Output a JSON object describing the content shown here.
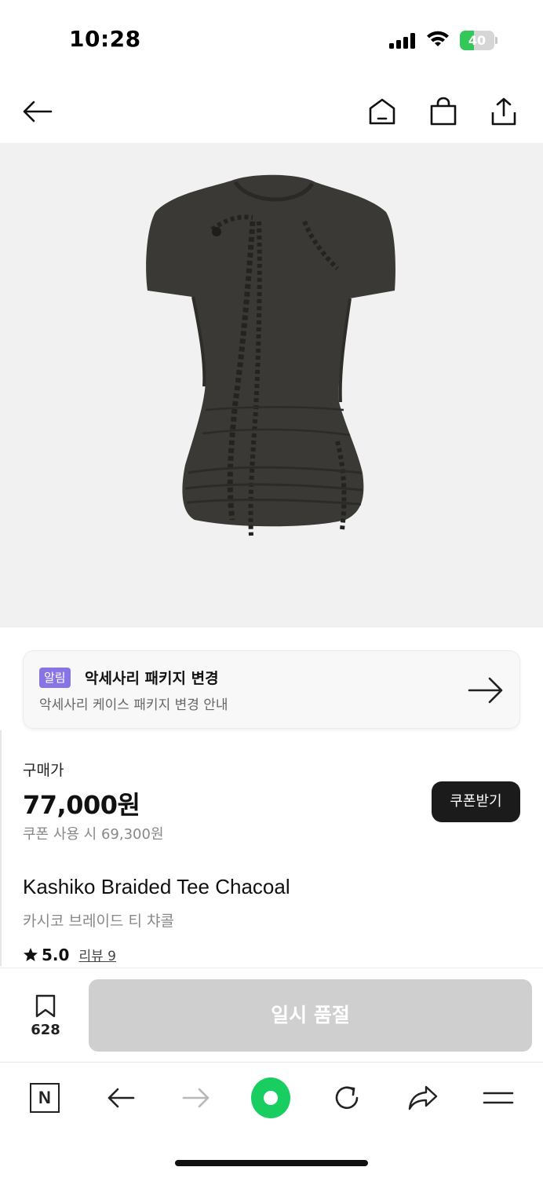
{
  "status_bar": {
    "time": "10:28",
    "battery": "40",
    "battery_level": 0.4,
    "battery_color": "#34c759"
  },
  "nav": {
    "icons": [
      "back-arrow-icon",
      "home-icon",
      "shopping-bag-icon",
      "share-icon"
    ]
  },
  "product_image": {
    "background": "#f1f1f1",
    "garment_color": "#3a3935"
  },
  "notice": {
    "badge": "알림",
    "badge_color": "#8875e3",
    "title": "악세사리 패키지 변경",
    "subtitle": "악세사리 케이스 패키지 변경 안내"
  },
  "price": {
    "label": "구매가",
    "amount": "77,000원",
    "coupon_text": "쿠폰 사용 시 69,300원",
    "coupon_button": "쿠폰받기"
  },
  "product": {
    "name_en": "Kashiko Braided Tee Chacoal",
    "name_ko": "카시코 브레이드 티 챠콜",
    "rating": "5.0",
    "review_link": "리뷰 9"
  },
  "buy_bar": {
    "wish_count": "628",
    "soldout_label": "일시 품절"
  },
  "browser": {
    "logo_letter": "N",
    "accent": "#19ce60",
    "icons": [
      "naver-logo-icon",
      "back-icon",
      "forward-icon",
      "green-home-icon",
      "reload-icon",
      "share-icon",
      "menu-icon"
    ]
  }
}
